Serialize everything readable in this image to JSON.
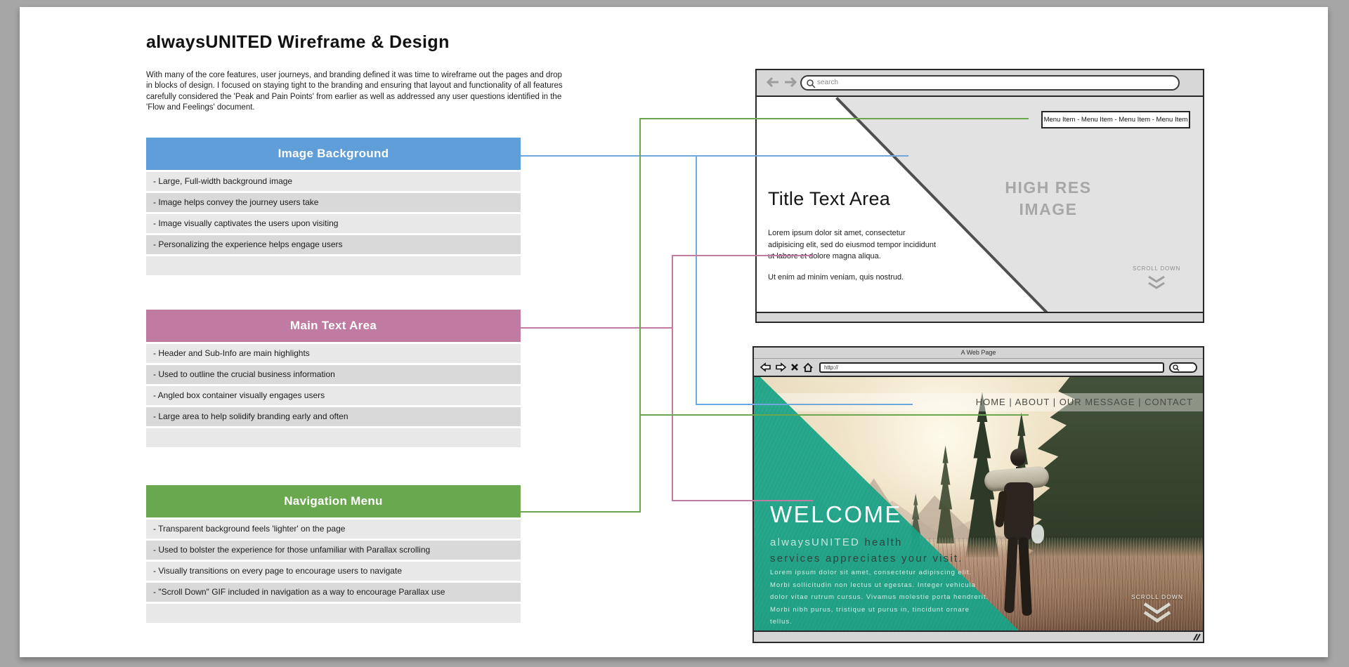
{
  "page": {
    "title": "alwaysUNITED Wireframe & Design",
    "intro": "With many of the core features, user journeys, and branding defined it was time to wireframe out the pages and drop in blocks of design. I focused on staying tight to the branding and ensuring that layout and functionality of all features carefully considered the 'Peak and Pain Points' from earlier as well as addressed any user questions identified in the 'Flow and Feelings' document."
  },
  "sections": [
    {
      "label": "Image Background",
      "color": "#5f9ed8",
      "items": [
        "- Large, Full-width background image",
        "- Image helps convey the journey users take",
        "- Image visually captivates the users upon visiting",
        "- Personalizing the experience helps engage users"
      ]
    },
    {
      "label": "Main Text Area",
      "color": "#c07ba2",
      "items": [
        "- Header and Sub-Info are main highlights",
        "- Used to outline the crucial business information",
        "- Angled box container visually engages users",
        "- Large area to help solidify branding early and often"
      ]
    },
    {
      "label": "Navigation Menu",
      "color": "#69a84f",
      "items": [
        "- Transparent background feels 'lighter' on the page",
        "- Used to bolster the experience for those unfamiliar with Parallax scrolling",
        "- Visually transitions on every page to encourage users to navigate",
        "- \"Scroll Down\" GIF included in navigation as a way to encourage Parallax use"
      ]
    }
  ],
  "wireframe": {
    "search_placeholder": "search",
    "menu_bar": "Menu Item - Menu Item - Menu Item - Menu Item",
    "title": "Title Text Area",
    "body_p1": "Lorem ipsum dolor sit amet, consectetur adipisicing elit, sed do eiusmod tempor incididunt ut labore et dolore magna aliqua.",
    "body_p2": "Ut enim ad minim veniam, quis nostrud.",
    "image_line1": "HIGH RES",
    "image_line2": "IMAGE",
    "scroll_label": "SCROLL DOWN"
  },
  "design": {
    "window_title": "A Web Page",
    "url_value": "http://",
    "nav": "HOME | ABOUT | OUR MESSAGE | CONTACT",
    "welcome": "WELCOME",
    "tagline_brand": "alwaysUNITED",
    "tagline_line1_rest": " health",
    "tagline_line2": "services appreciates your visit.",
    "body": "Lorem ipsum dolor sit amet, consectetur adipiscing elit. Morbi sollicitudin non lectus ut egestas. Integer vehicula dolor vitae rutrum cursus. Vivamus molestie porta hendrerit. Morbi nibh purus, tristique ut purus in, tincidunt ornare tellus.",
    "scroll_label": "SCROLL DOWN"
  },
  "colors": {
    "blue": "#5f9ed8",
    "pink": "#c07ba2",
    "green": "#69a84f",
    "teal": "#17a186"
  }
}
